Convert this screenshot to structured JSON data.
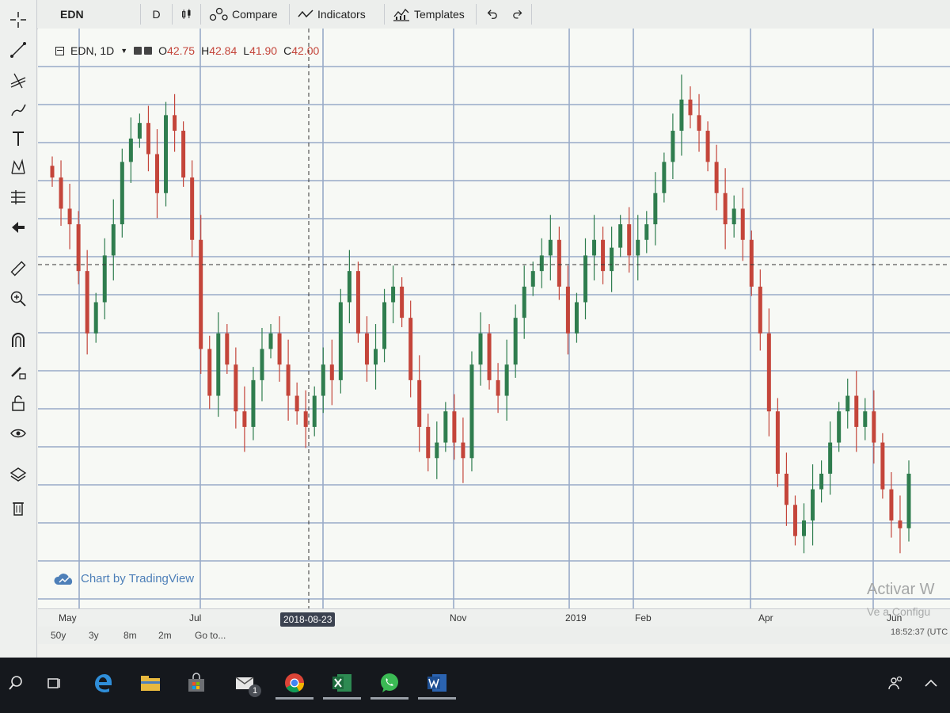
{
  "toolbar": {
    "symbol": "EDN",
    "interval": "D",
    "compare_label": "Compare",
    "indicators_label": "Indicators",
    "templates_label": "Templates"
  },
  "legend": {
    "symbol_interval": "EDN, 1D",
    "open_label": "O",
    "open": "42.75",
    "high_label": "H",
    "high": "42.84",
    "low_label": "L",
    "low": "41.90",
    "close_label": "C",
    "close": "42.00"
  },
  "watermark": "Chart by TradingView",
  "xaxis": {
    "labels": [
      "May",
      "Jul",
      "Nov",
      "2019",
      "Feb",
      "Apr",
      "Jun"
    ],
    "crosshair_date": "2018-08-23"
  },
  "ranges": [
    "50y",
    "3y",
    "8m",
    "2m"
  ],
  "goto_label": "Go to...",
  "clock": "18:52:37 (UTC",
  "windows_overlay": {
    "line1": "Activar W",
    "line2": "Ve a Configu"
  },
  "taskbar": {
    "mail_badge": "1"
  },
  "colors": {
    "up": "#2f7d4e",
    "down": "#c4453a",
    "grid": "#98aac8",
    "accent": "#4d7fb8"
  },
  "chart_data": {
    "type": "candlestick",
    "x_labels": [
      "May",
      "Jul",
      "Nov",
      "2019",
      "Feb",
      "Apr",
      "Jun"
    ],
    "crosshair": {
      "date": "2018-08-23"
    },
    "last_bar": {
      "open": 42.75,
      "high": 42.84,
      "low": 41.9,
      "close": 42.0
    },
    "closes_shape": [
      50,
      46,
      44,
      38,
      30,
      34,
      40,
      44,
      52,
      55,
      57,
      53,
      48,
      58,
      56,
      50,
      42,
      28,
      22,
      30,
      26,
      20,
      18,
      24,
      28,
      30,
      26,
      22,
      20,
      18,
      22,
      26,
      24,
      34,
      38,
      30,
      26,
      28,
      34,
      36,
      32,
      24,
      18,
      14,
      16,
      20,
      16,
      14,
      26,
      30,
      24,
      22,
      26,
      32,
      36,
      38,
      40,
      42,
      36,
      30,
      34,
      40,
      42,
      38,
      41,
      44,
      40,
      42,
      44,
      48,
      52,
      56,
      60,
      58,
      56,
      52,
      48,
      44,
      46,
      42,
      36,
      30,
      20,
      12,
      8,
      4,
      6,
      10,
      12,
      16,
      20,
      22,
      18,
      20,
      16,
      10,
      6,
      5,
      12
    ]
  }
}
